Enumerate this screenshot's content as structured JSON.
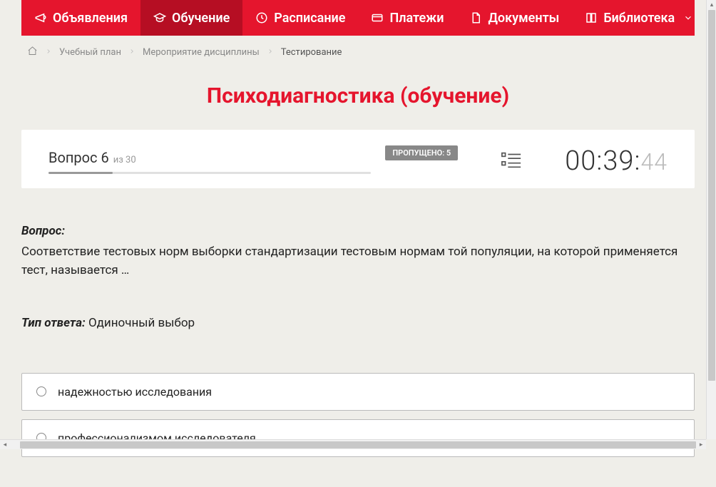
{
  "nav": {
    "items": [
      {
        "label": "Объявления",
        "icon": "megaphone"
      },
      {
        "label": "Обучение",
        "icon": "graduation",
        "active": true
      },
      {
        "label": "Расписание",
        "icon": "clock"
      },
      {
        "label": "Платежи",
        "icon": "card"
      },
      {
        "label": "Документы",
        "icon": "document"
      },
      {
        "label": "Библиотека",
        "icon": "book",
        "dropdown": true
      }
    ]
  },
  "breadcrumb": {
    "items": [
      {
        "label": "Учебный план"
      },
      {
        "label": "Мероприятие дисциплины"
      }
    ],
    "current": "Тестирование"
  },
  "page_title": "Психодиагностика (обучение)",
  "quiz": {
    "question_label": "Вопрос 6",
    "of_label": "из 30",
    "skipped_label": "ПРОПУЩЕНО: 5",
    "timer_main": "00:39:",
    "timer_ms": "44"
  },
  "question": {
    "label": "Вопрос:",
    "text": "Соответствие тестовых норм выборки стандартизации тестовым нормам той популяции, на которой применяется тест, называется …"
  },
  "answer_type": {
    "label": "Тип ответа:",
    "value": "Одиночный выбор"
  },
  "answers": [
    {
      "text": "надежностью исследования"
    },
    {
      "text": "профессионализмом исследователя"
    }
  ]
}
